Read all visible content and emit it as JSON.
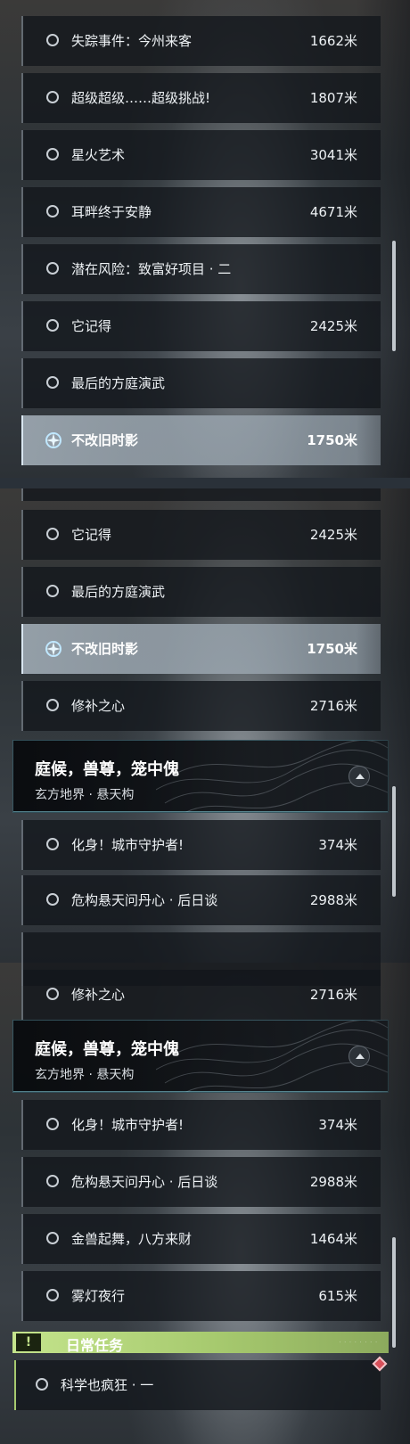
{
  "unit": "米",
  "panel1": {
    "quests": [
      {
        "name": "失踪事件：今州来客",
        "distance": "1662米"
      },
      {
        "name": "超级超级……超级挑战!",
        "distance": "1807米"
      },
      {
        "name": "星火艺术",
        "distance": "3041米"
      },
      {
        "name": "耳畔终于安静",
        "distance": "4671米"
      },
      {
        "name": "潜在风险：致富好项目 · 二",
        "distance": ""
      },
      {
        "name": "它记得",
        "distance": "2425米"
      },
      {
        "name": "最后的方庭演武",
        "distance": ""
      },
      {
        "name": "不改旧时影",
        "distance": "1750米",
        "selected": true
      }
    ]
  },
  "panel2": {
    "quests_before": [
      {
        "name": "它记得",
        "distance": "2425米"
      },
      {
        "name": "最后的方庭演武",
        "distance": ""
      },
      {
        "name": "不改旧时影",
        "distance": "1750米",
        "selected": true
      },
      {
        "name": "修补之心",
        "distance": "2716米"
      }
    ],
    "section": {
      "title": "庭候，兽尊，笼中傀",
      "subtitle": "玄方地界 · 悬天构"
    },
    "quests_after": [
      {
        "name": "化身！城市守护者!",
        "distance": "374米"
      },
      {
        "name": "危构悬天问丹心 · 后日谈",
        "distance": "2988米"
      }
    ]
  },
  "panel3": {
    "quests_before": [
      {
        "name": "修补之心",
        "distance": "2716米"
      }
    ],
    "section": {
      "title": "庭候，兽尊，笼中傀",
      "subtitle": "玄方地界 · 悬天构"
    },
    "quests_after": [
      {
        "name": "化身！城市守护者!",
        "distance": "374米"
      },
      {
        "name": "危构悬天问丹心 · 后日谈",
        "distance": "2988米"
      },
      {
        "name": "金兽起舞，八方来财",
        "distance": "1464米"
      },
      {
        "name": "雾灯夜行",
        "distance": "615米"
      }
    ],
    "daily": {
      "icon": "!",
      "label": "日常任务",
      "quests": [
        {
          "name": "科学也疯狂 · 一",
          "distance": ""
        }
      ]
    }
  },
  "colors": {
    "selected_row": "#aab6c0",
    "daily_accent": "#a6c96e",
    "section_border": "#78c8dc",
    "waypoint_marker": "#d8505a"
  },
  "icons": {
    "quest_status": "circle-outline-icon",
    "tracked": "crosshair-target-icon",
    "collapse": "chevron-up-icon",
    "daily": "exclamation-icon",
    "marker": "diamond-marker-icon"
  }
}
